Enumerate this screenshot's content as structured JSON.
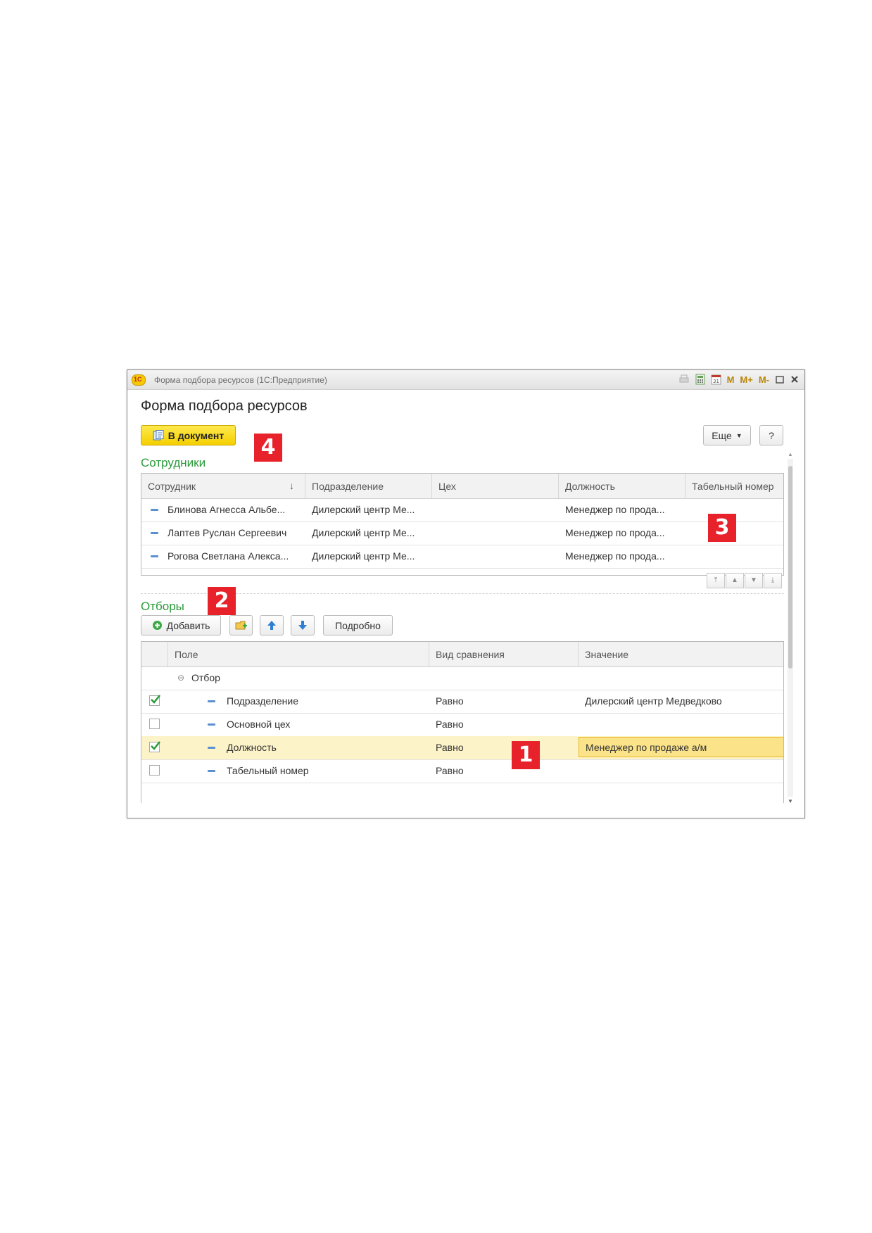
{
  "window": {
    "title": "Форма подбора ресурсов  (1С:Предприятие)",
    "toolbar_m": [
      "M",
      "M+",
      "M-"
    ]
  },
  "form": {
    "title": "Форма подбора ресурсов",
    "to_document_label": "В документ",
    "more_label": "Еще",
    "help_label": "?"
  },
  "employees": {
    "section_title": "Сотрудники",
    "columns": [
      "Сотрудник",
      "Подразделение",
      "Цех",
      "Должность",
      "Табельный номер"
    ],
    "sort_indicator": "↓",
    "rows": [
      {
        "employee": "Блинова Агнесса Альбе...",
        "department": "Дилерский центр Ме...",
        "workshop": "",
        "position": "Менеджер по прода...",
        "tab_number": ""
      },
      {
        "employee": "Лаптев Руслан Сергеевич",
        "department": "Дилерский центр Ме...",
        "workshop": "",
        "position": "Менеджер по прода...",
        "tab_number": ""
      },
      {
        "employee": "Рогова Светлана Алекса...",
        "department": "Дилерский центр Ме...",
        "workshop": "",
        "position": "Менеджер по прода...",
        "tab_number": ""
      }
    ]
  },
  "filters": {
    "section_title": "Отборы",
    "add_label": "Добавить",
    "details_label": "Подробно",
    "columns": [
      "Поле",
      "Вид сравнения",
      "Значение"
    ],
    "group_label": "Отбор",
    "rows": [
      {
        "checked": true,
        "field": "Подразделение",
        "comparison": "Равно",
        "value": "Дилерский центр Медведково"
      },
      {
        "checked": false,
        "field": "Основной цех",
        "comparison": "Равно",
        "value": ""
      },
      {
        "checked": true,
        "field": "Должность",
        "comparison": "Равно",
        "value": "Менеджер по продаже а/м"
      },
      {
        "checked": false,
        "field": "Табельный номер",
        "comparison": "Равно",
        "value": ""
      }
    ]
  },
  "callouts": [
    "1",
    "2",
    "3",
    "4"
  ],
  "colors": {
    "accent_green": "#2a9a3a",
    "callout_red": "#e8222a",
    "primary_button_yellow": "#f5cf00",
    "selected_row": "#fdf3c8"
  }
}
